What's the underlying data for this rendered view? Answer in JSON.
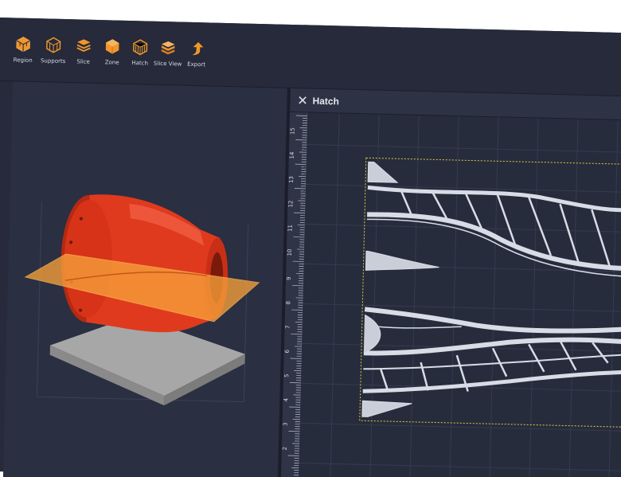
{
  "toolbar": {
    "items": [
      {
        "label": "Region",
        "icon": "region-cube-icon"
      },
      {
        "label": "Supports",
        "icon": "supports-cube-icon"
      },
      {
        "label": "Slice",
        "icon": "slice-layers-icon"
      },
      {
        "label": "Zone",
        "icon": "zone-cube-icon"
      },
      {
        "label": "Hatch",
        "icon": "hatch-cube-icon"
      },
      {
        "label": "Slice View",
        "icon": "slice-view-layers-icon"
      },
      {
        "label": "Export",
        "icon": "export-arrow-icon"
      }
    ]
  },
  "hatch_panel": {
    "title": "Hatch",
    "ruler_labels": [
      "15",
      "14",
      "13",
      "12",
      "11",
      "10",
      "9",
      "8",
      "7",
      "6",
      "5",
      "4",
      "3",
      "2"
    ]
  },
  "colors": {
    "accent": "#f0972b",
    "background": "#262a3a",
    "model": "#e03a1e",
    "slice_plane": "#f6a13a",
    "build_plate": "#a7a7a7",
    "hatch_lines": "#d8dce6",
    "boundary": "#e3c84a"
  }
}
